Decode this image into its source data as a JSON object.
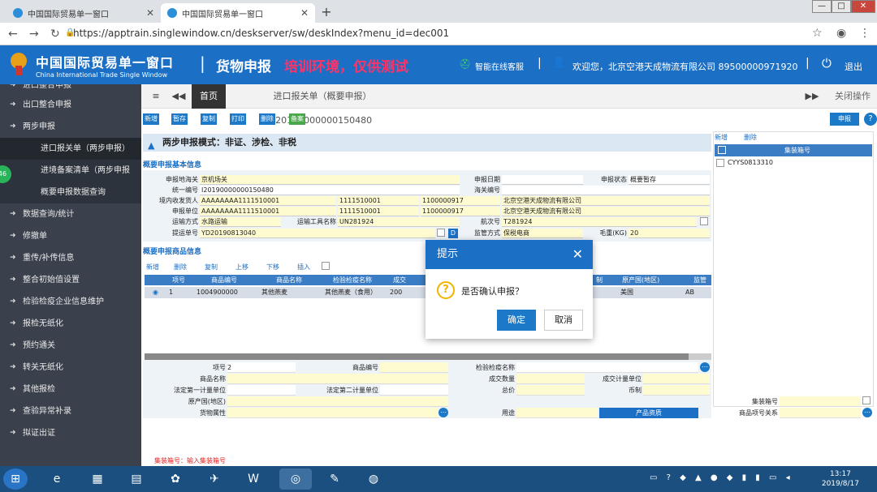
{
  "browser": {
    "tab1_title": "中国国际贸易单一窗口",
    "tab2_title": "中国国际贸易单一窗口",
    "url": "https://apptrain.singlewindow.cn/deskserver/sw/deskIndex?menu_id=dec001"
  },
  "header": {
    "brand": "中国国际贸易单一窗口",
    "brand_en": "China International Trade Single Window",
    "module": "货物申报",
    "env_warning": "培训环境，仅供测试",
    "help": "智能在线客服",
    "welcome": "欢迎您，北京空港天成物流有限公司 89500000971920",
    "logout": "退出"
  },
  "sidebar": {
    "items": [
      {
        "label": "进口整合申报"
      },
      {
        "label": "出口整合申报"
      },
      {
        "label": "两步申报"
      },
      {
        "label": "进口报关单（两步申报）"
      },
      {
        "label": "进境备案清单（两步申报"
      },
      {
        "label": "概要申报数据查询"
      },
      {
        "label": "数据查询/统计"
      },
      {
        "label": "修撤单"
      },
      {
        "label": "重传/补传信息"
      },
      {
        "label": "整合初始值设置"
      },
      {
        "label": "检验检疫企业信息维护"
      },
      {
        "label": "报检无纸化"
      },
      {
        "label": "预约通关"
      },
      {
        "label": "转关无纸化"
      },
      {
        "label": "其他报检"
      },
      {
        "label": "查验异常补录"
      },
      {
        "label": "拟证出证"
      }
    ],
    "badge": "46"
  },
  "content_tabs": {
    "home": "首页",
    "doc": "进口报关单（概要申报）I20190000000150480",
    "close_ops": "关闭操作"
  },
  "toolbar": {
    "add": "新增",
    "save": "暂存",
    "copy": "复制",
    "print": "打印",
    "delete": "删除",
    "record": "备案",
    "declare": "申报"
  },
  "banner": "两步申报模式：非证、涉检、非税",
  "form": {
    "section": "概要申报基本信息",
    "decl_customs_label": "申报地海关",
    "decl_customs": "京机场关",
    "decl_date_label": "申报日期",
    "decl_status_label": "申报状态",
    "decl_status": "概要暂存",
    "unified_no_label": "统一编号",
    "unified_no": "I20190000000150480",
    "customs_no_label": "海关编号",
    "consignee_label": "境内收发货人",
    "consignee_code": "AAAAAAAA1111510001",
    "consignee_code2": "1111510001",
    "consignee_code3": "1100000917",
    "consignee_name": "北京空港天成物流有限公司",
    "declarant_label": "申报单位",
    "declarant_code": "AAAAAAAA1111510001",
    "declarant_code2": "1111510001",
    "declarant_code3": "1100000917",
    "declarant_name": "北京空港天成物流有限公司",
    "transport_label": "运输方式",
    "transport": "水路运输",
    "vessel_label": "运输工具名称",
    "vessel": "UN281924",
    "voyage_label": "航次号",
    "voyage": "T281924",
    "bl_label": "提运单号",
    "bl": "YD20190813040",
    "supervision_label": "监管方式",
    "supervision": "保税电商",
    "gross_label": "毛重(KG)",
    "gross": "20"
  },
  "goods": {
    "section": "概要申报商品信息",
    "buttons": {
      "add": "新增",
      "delete": "删除",
      "copy": "复制",
      "up": "上移",
      "down": "下移",
      "insert": "插入"
    },
    "columns": [
      "项号",
      "商品编号",
      "商品名称",
      "检验检疫名称",
      "成交",
      "",
      "",
      "制",
      "原产国(地区)",
      "监管"
    ],
    "rows": [
      {
        "item": "1",
        "code": "1004900000",
        "name": "其他燕麦",
        "ciq_name": "其他燕麦（食用）",
        "qty": "200",
        "origin": "美国",
        "sup": "AB"
      }
    ]
  },
  "right_panel": {
    "add": "新增",
    "delete": "删除",
    "header": "集装箱号",
    "container": "CYYS0813310"
  },
  "bottom": {
    "item_no_label": "项号",
    "item_no": "2",
    "goods_code_label": "商品编号",
    "ciq_name_label": "检验检疫名称",
    "goods_name_label": "商品名称",
    "deal_qty_label": "成交数量",
    "deal_unit_label": "成交计量单位",
    "legal_unit1_label": "法定第一计量单位",
    "legal_unit2_label": "法定第二计量单位",
    "total_label": "总价",
    "currency_label": "币制",
    "origin_label": "原产国(地区)",
    "attr_label": "货物属性",
    "usage_label": "用途",
    "qualify": "产品资质",
    "container_label": "集装箱号",
    "relation_label": "商品项号关系",
    "status": "集装箱号：输入集装箱号"
  },
  "dialog": {
    "title": "提示",
    "message": "是否确认申报？",
    "ok": "确定",
    "cancel": "取消"
  },
  "taskbar": {
    "time": "13:17",
    "date": "2019/8/17"
  },
  "colors": {
    "header_blue": "#1b6fc5",
    "sidebar": "#3a414d",
    "warning": "#ff3366"
  }
}
